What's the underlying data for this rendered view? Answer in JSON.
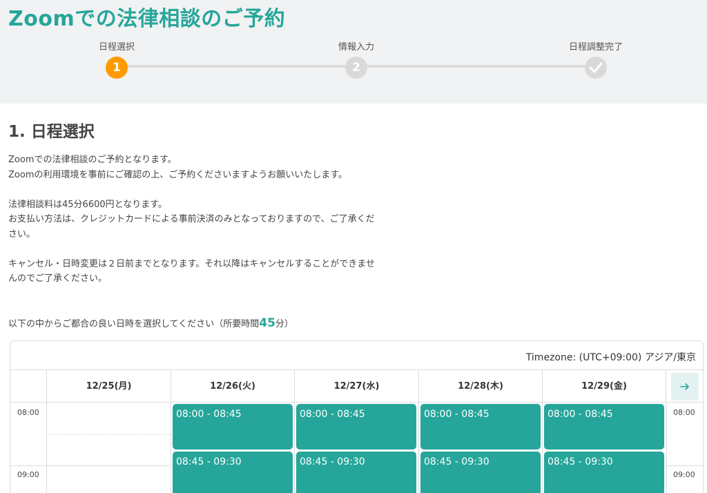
{
  "page": {
    "title": "Zoomでの法律相談のご予約"
  },
  "stepper": {
    "steps": [
      {
        "label": "日程選択",
        "number": "1",
        "state": "active"
      },
      {
        "label": "情報入力",
        "number": "2",
        "state": "pending"
      },
      {
        "label": "日程調整完了",
        "icon": "check-icon",
        "state": "pending"
      }
    ],
    "colors": {
      "active": "#ff9b00",
      "inactive": "#d9d9d9"
    }
  },
  "section": {
    "title": "1. 日程選択",
    "lines": {
      "l1": "Zoomでの法律相談のご予約となります。",
      "l2": "Zoomの利用環境を事前にご確認の上、ご予約くださいますようお願いいたします。",
      "l3": "法律相談料は45分6600円となります。",
      "l4a": "お支払い方法は、クレジットカードによる事前決済のみとなっておりますので、ご了承くだ",
      "l4b": "さい。",
      "l5a": "キャンセル・日時変更は２日前までとなります。それ以降はキャンセルすることができませ",
      "l5b": "んのでご了承ください。",
      "prompt_before": "以下の中からご都合の良い日時を選択してください（所要時間",
      "duration": "45",
      "prompt_after": "分）"
    }
  },
  "calendar": {
    "timezone": "Timezone: (UTC+09:00) アジア/東京",
    "days": [
      "12/25(月)",
      "12/26(火)",
      "12/27(水)",
      "12/28(木)",
      "12/29(金)"
    ],
    "times": [
      "08:00",
      "09:00"
    ],
    "next_icon": "arrow-right-icon",
    "slots": {
      "s1": "08:00 - 08:45",
      "s2": "08:45 - 09:30"
    },
    "accent": "#26a69a"
  }
}
